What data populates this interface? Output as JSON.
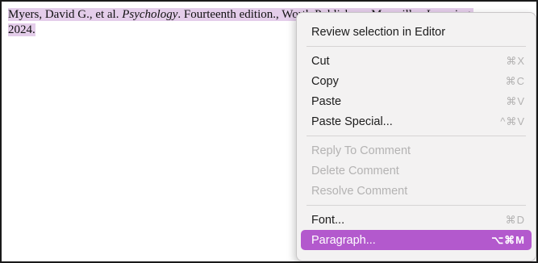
{
  "document": {
    "citation_authors": "Myers, David G., et al. ",
    "citation_title": "Psychology",
    "citation_edition": ". Fourteenth edition., ",
    "citation_publisher": "Worth Publishers, Macmillan Learning, ",
    "citation_year": "2024."
  },
  "menu": {
    "review": "Review selection in Editor",
    "cut": {
      "label": "Cut",
      "shortcut": "⌘X"
    },
    "copy": {
      "label": "Copy",
      "shortcut": "⌘C"
    },
    "paste": {
      "label": "Paste",
      "shortcut": "⌘V"
    },
    "paste_special": {
      "label": "Paste Special...",
      "shortcut": "^⌘V"
    },
    "reply_to_comment": "Reply To Comment",
    "delete_comment": "Delete Comment",
    "resolve_comment": "Resolve Comment",
    "font": {
      "label": "Font...",
      "shortcut": "⌘D"
    },
    "paragraph": {
      "label": "Paragraph...",
      "shortcut": "⌥⌘M"
    }
  },
  "colors": {
    "selection_highlight": "#e4cdea",
    "menu_highlight": "#b359cd"
  }
}
